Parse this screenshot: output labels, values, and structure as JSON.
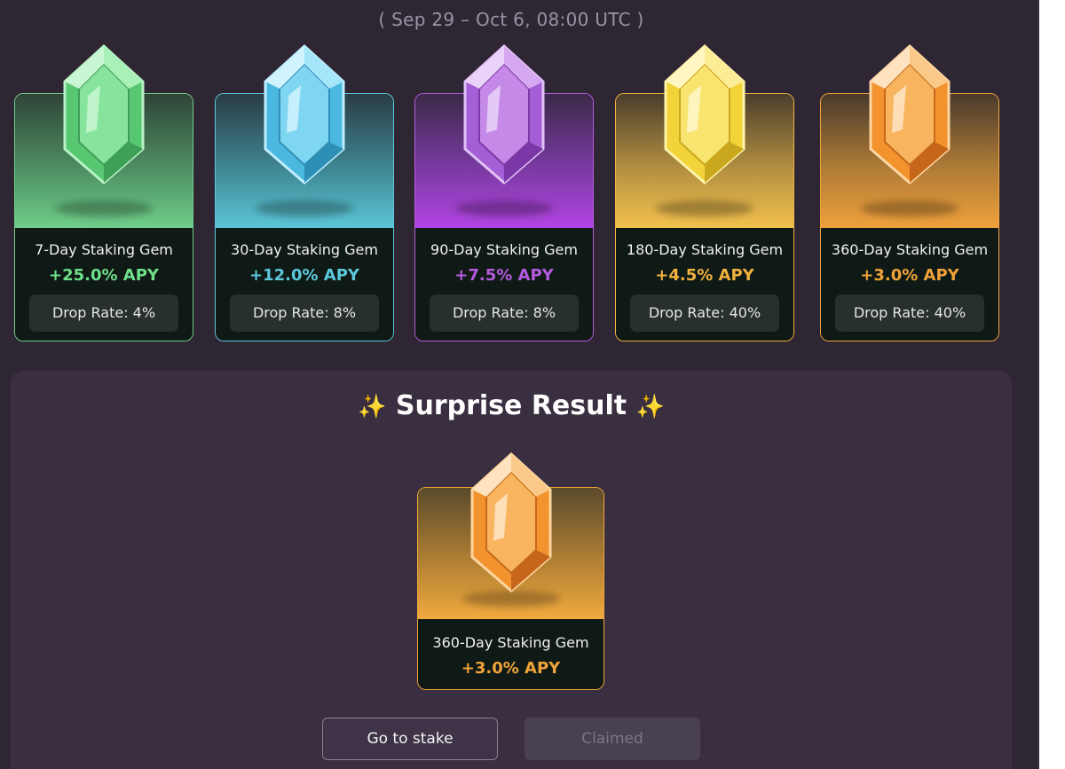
{
  "header": {
    "date_range": "( Sep 29 – Oct 6, 08:00 UTC )"
  },
  "gems": [
    {
      "name": "7-Day Staking Gem",
      "apy": "+25.0% APY",
      "drop_rate": "Drop Rate: 4%",
      "color": "#6fe08a",
      "icon": "green-gem-icon"
    },
    {
      "name": "30-Day Staking Gem",
      "apy": "+12.0% APY",
      "drop_rate": "Drop Rate: 8%",
      "color": "#5cc8dc",
      "icon": "blue-gem-icon"
    },
    {
      "name": "90-Day Staking Gem",
      "apy": "+7.5% APY",
      "drop_rate": "Drop Rate: 8%",
      "color": "#b65be0",
      "icon": "purple-gem-icon"
    },
    {
      "name": "180-Day Staking Gem",
      "apy": "+4.5% APY",
      "drop_rate": "Drop Rate: 40%",
      "color": "#f0b33e",
      "icon": "yellow-gem-icon"
    },
    {
      "name": "360-Day Staking Gem",
      "apy": "+3.0% APY",
      "drop_rate": "Drop Rate: 40%",
      "color": "#f0a23a",
      "icon": "orange-gem-icon"
    }
  ],
  "result": {
    "title": "Surprise Result",
    "title_icon": "sparkles-icon",
    "gem_name": "360-Day Staking Gem",
    "gem_apy": "+3.0% APY",
    "gem_icon": "orange-gem-icon"
  },
  "actions": {
    "stake_label": "Go to stake",
    "claimed_label": "Claimed"
  }
}
